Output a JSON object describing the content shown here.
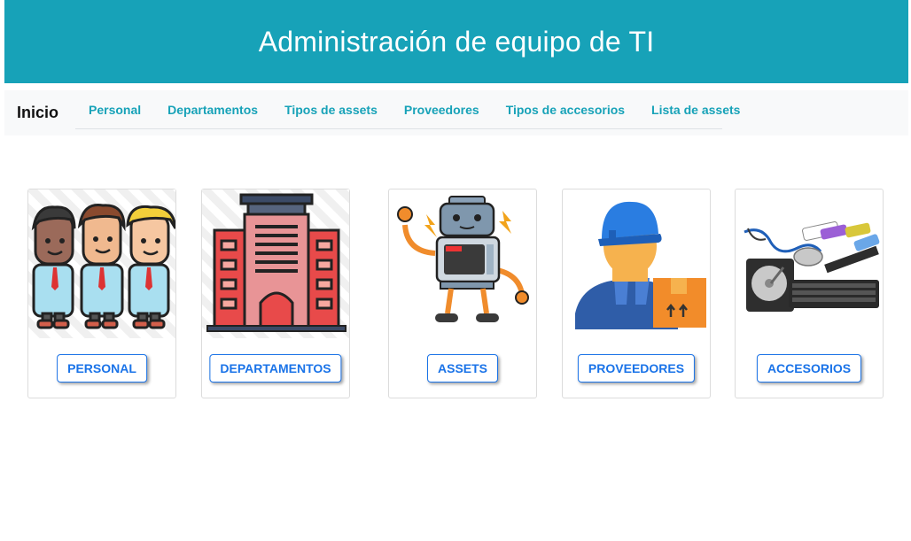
{
  "header": {
    "title": "Administración de equipo de TI"
  },
  "nav": {
    "brand": "Inicio",
    "links": [
      "Personal",
      "Departamentos",
      "Tipos de assets",
      "Proveedores",
      "Tipos de accesorios",
      "Lista de assets"
    ]
  },
  "cards": [
    {
      "button": "PERSONAL",
      "icon": "people-group-icon"
    },
    {
      "button": "DEPARTAMENTOS",
      "icon": "office-building-icon"
    },
    {
      "button": "ASSETS",
      "icon": "robot-icon"
    },
    {
      "button": "PROVEEDORES",
      "icon": "delivery-worker-icon"
    },
    {
      "button": "ACCESORIOS",
      "icon": "computer-accessories-icon"
    }
  ],
  "colors": {
    "header_bg": "#17a2b8",
    "nav_link": "#17a2b8",
    "button_accent": "#1a73e8",
    "navbar_bg": "#f8f9fa"
  }
}
